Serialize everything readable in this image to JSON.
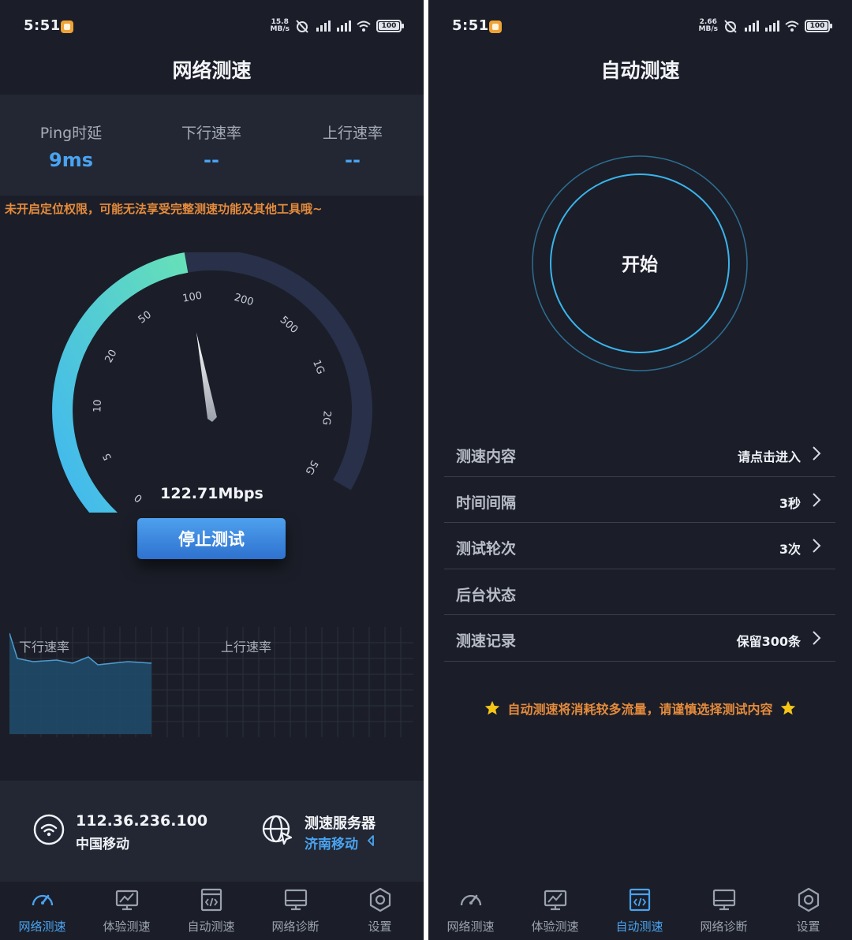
{
  "status_bar_left": {
    "time": "5:51",
    "net_speed_value": "15.8",
    "net_speed_unit": "MB/s",
    "battery": "100"
  },
  "status_bar_right": {
    "time": "5:51",
    "net_speed_value": "2.66",
    "net_speed_unit": "MB/s",
    "battery": "100"
  },
  "speed_test": {
    "title": "网络测速",
    "metrics": [
      {
        "label": "Ping时延",
        "value": "9ms"
      },
      {
        "label": "下行速率",
        "value": "--"
      },
      {
        "label": "上行速率",
        "value": "--"
      }
    ],
    "warning": "未开启定位权限，可能无法享受完整测速功能及其他工具哦~",
    "gauge": {
      "ticks": [
        "0",
        "5",
        "10",
        "20",
        "50",
        "100",
        "200",
        "500",
        "1G",
        "2G",
        "5G"
      ],
      "progress_fraction": 0.5,
      "needle_tick": "100"
    },
    "speed_readout": "122.71Mbps",
    "stop_button": "停止测试",
    "graphs": {
      "download_label": "下行速率",
      "upload_label": "上行速率"
    },
    "ip": {
      "address": "112.36.236.100",
      "isp": "中国移动"
    },
    "server": {
      "title": "测速服务器",
      "name": "济南移动"
    }
  },
  "auto_test": {
    "title": "自动测速",
    "start_button": "开始",
    "settings": [
      {
        "label": "测速内容",
        "value": "请点击进入",
        "chevron": true
      },
      {
        "label": "时间间隔",
        "value": "3秒",
        "chevron": true
      },
      {
        "label": "测试轮次",
        "value": "3次",
        "chevron": true
      },
      {
        "label": "后台状态",
        "value": "",
        "chevron": false
      },
      {
        "label": "测速记录",
        "value": "保留300条",
        "chevron": true
      }
    ],
    "notice": "自动测速将消耗较多流量，请谨慎选择测试内容"
  },
  "tabs": [
    {
      "label": "网络测速",
      "icon": "gauge-icon"
    },
    {
      "label": "体验测速",
      "icon": "chart-monitor-icon"
    },
    {
      "label": "自动测速",
      "icon": "code-window-icon"
    },
    {
      "label": "网络诊断",
      "icon": "monitor-icon"
    },
    {
      "label": "设置",
      "icon": "hexagon-settings-icon"
    }
  ],
  "active_tab_left": 0,
  "active_tab_right": 2,
  "colors": {
    "background": "#1b1e28",
    "band": "#222733",
    "accent_blue": "#4aa3f0",
    "warning_orange": "#e58b3c",
    "gauge_start": "#3fb6f2",
    "gauge_end": "#66e0b8",
    "gauge_track": "#28304a"
  }
}
